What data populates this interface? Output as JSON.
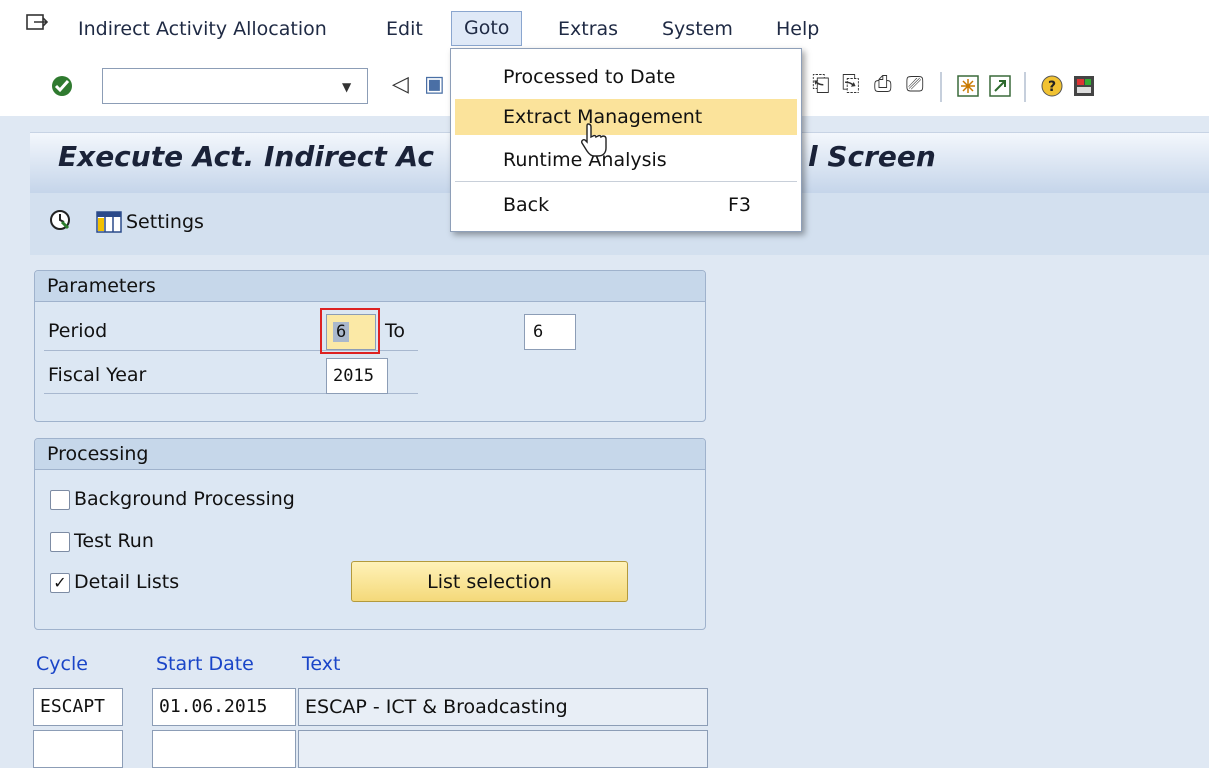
{
  "menubar": {
    "items": [
      {
        "label": "Indirect Activity Allocation"
      },
      {
        "label": "Edit"
      },
      {
        "label": "Goto"
      },
      {
        "label": "Extras"
      },
      {
        "label": "System"
      },
      {
        "label": "Help"
      }
    ]
  },
  "goto_menu": {
    "items": [
      {
        "label": "Processed to Date",
        "shortcut": ""
      },
      {
        "label": "Extract Management",
        "shortcut": ""
      },
      {
        "label": "Runtime Analysis",
        "shortcut": ""
      },
      {
        "label": "Back",
        "shortcut": "F3"
      }
    ],
    "highlighted": "Extract Management"
  },
  "toolbar": {
    "command_value": ""
  },
  "title": {
    "left": "Execute Act. Indirect Ac",
    "right": "l Screen"
  },
  "app_toolbar": {
    "settings_label": "Settings"
  },
  "parameters": {
    "header": "Parameters",
    "period_label": "Period",
    "period_from": "6",
    "to_label": "To",
    "period_to": "6",
    "fiscal_year_label": "Fiscal Year",
    "fiscal_year": "2015"
  },
  "processing": {
    "header": "Processing",
    "background_label": "Background Processing",
    "background_checked": false,
    "test_run_label": "Test Run",
    "test_run_checked": false,
    "detail_lists_label": "Detail Lists",
    "detail_lists_checked": true,
    "detail_lists_mark": "✓",
    "list_selection_label": "List selection"
  },
  "cycles": {
    "headers": {
      "cycle": "Cycle",
      "start_date": "Start Date",
      "text": "Text"
    },
    "rows": [
      {
        "cycle": "ESCAPT",
        "start_date": "01.06.2015",
        "text": "ESCAP - ICT & Broadcasting"
      }
    ]
  },
  "colors": {
    "accent": "#fbe39b",
    "header_blue": "#1a45c8",
    "background": "#dfe8f3"
  }
}
